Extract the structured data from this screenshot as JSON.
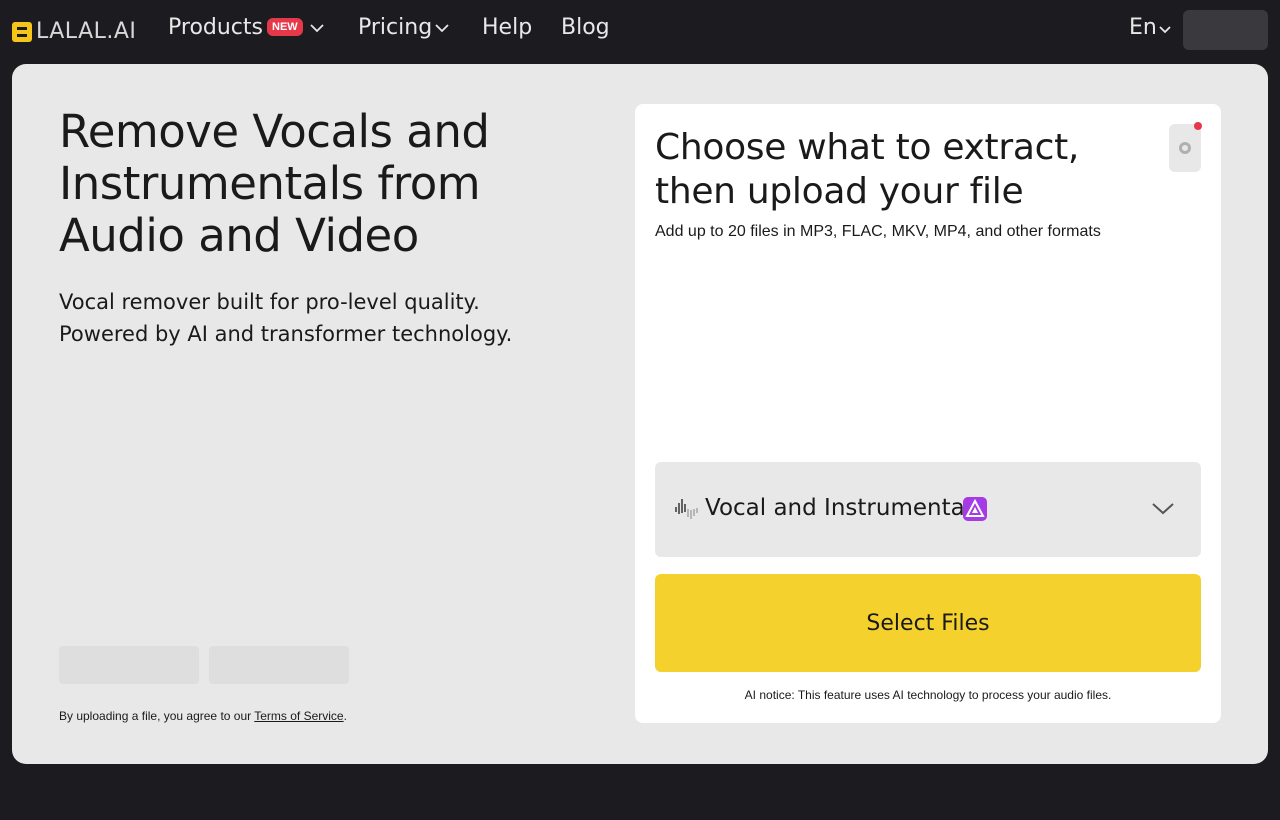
{
  "header": {
    "logo_text": "LALAL.AI",
    "nav": {
      "products": "Products",
      "products_badge": "NEW",
      "pricing": "Pricing",
      "help": "Help",
      "blog": "Blog"
    },
    "language": "En"
  },
  "hero": {
    "title": "Remove Vocals and Instrumentals from Audio and Video",
    "subtitle_line1": "Vocal remover built for pro-level quality.",
    "subtitle_line2": "Powered by AI and transformer technology.",
    "terms_prefix": "By uploading a file, you agree to our ",
    "terms_link": "Terms of Service",
    "terms_suffix": "."
  },
  "upload_panel": {
    "title": "Choose what to extract, then upload your file",
    "subtitle": "Add up to 20 files in MP3, FLAC, MKV, MP4, and other formats",
    "selected_option": "Vocal and Instrumental",
    "select_button": "Select Files",
    "ai_notice": "AI notice: This feature uses AI technology to process your audio files."
  },
  "colors": {
    "background": "#1c1b1f",
    "card": "#e8e8e8",
    "accent_yellow": "#f5d12e",
    "badge_red": "#e5394a",
    "ai_purple": "#a43be5"
  },
  "icons": [
    "logo-icon",
    "chevron-down-icon",
    "gear-icon",
    "notification-dot",
    "waveform-icon",
    "ai-icon"
  ]
}
